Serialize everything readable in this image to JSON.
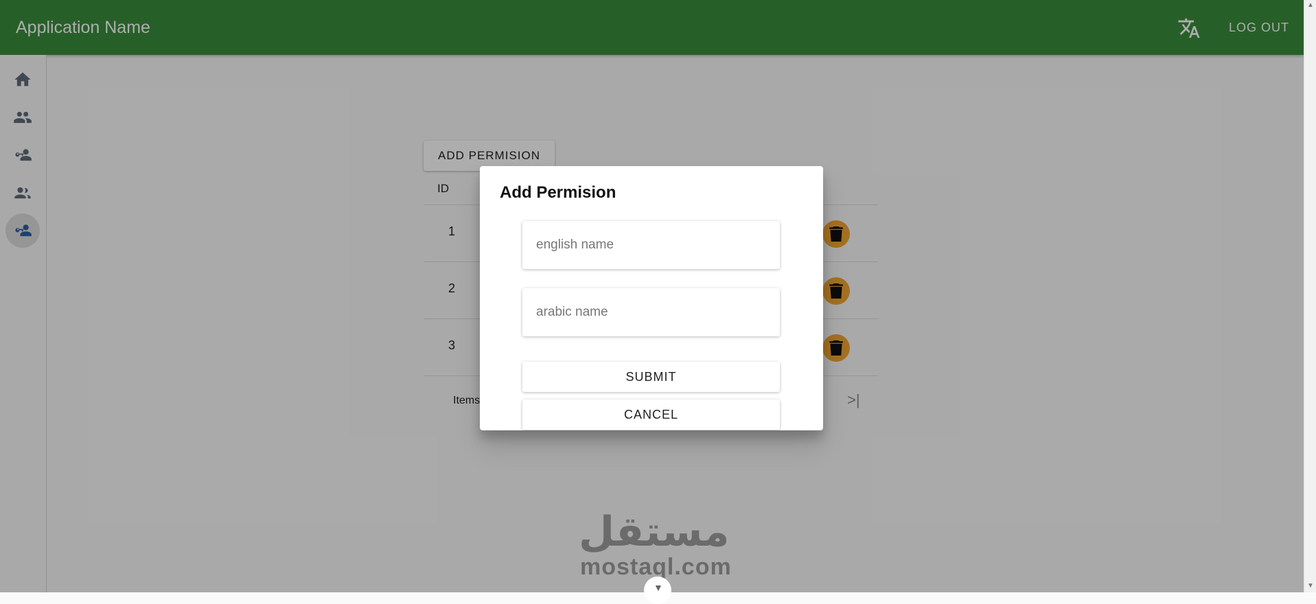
{
  "topbar": {
    "app_title": "Application Name",
    "translate_icon": "translate-icon",
    "logout_label": "LOG OUT",
    "color": "#388e3c"
  },
  "sidebar": {
    "items": [
      {
        "icon": "home-icon",
        "active": false
      },
      {
        "icon": "users-icon",
        "active": false
      },
      {
        "icon": "user-key-icon",
        "active": false
      },
      {
        "icon": "group-icon",
        "active": false
      },
      {
        "icon": "user-key-icon",
        "active": true
      }
    ]
  },
  "main": {
    "add_button_label": "ADD PERMISION",
    "table": {
      "id_header": "ID",
      "rows": [
        {
          "id": "1"
        },
        {
          "id": "2"
        },
        {
          "id": "3"
        }
      ]
    },
    "paginator": {
      "items_label": "Items",
      "last_page_glyph": ">|"
    }
  },
  "dialog": {
    "title": "Add Permision",
    "english_placeholder": "english name",
    "arabic_placeholder": "arabic name",
    "submit_label": "SUBMIT",
    "cancel_label": "CANCEL"
  },
  "watermark": {
    "arabic": "مستقل",
    "latin": "mostaql.com"
  },
  "colors": {
    "delete_button": "#f2a531"
  }
}
